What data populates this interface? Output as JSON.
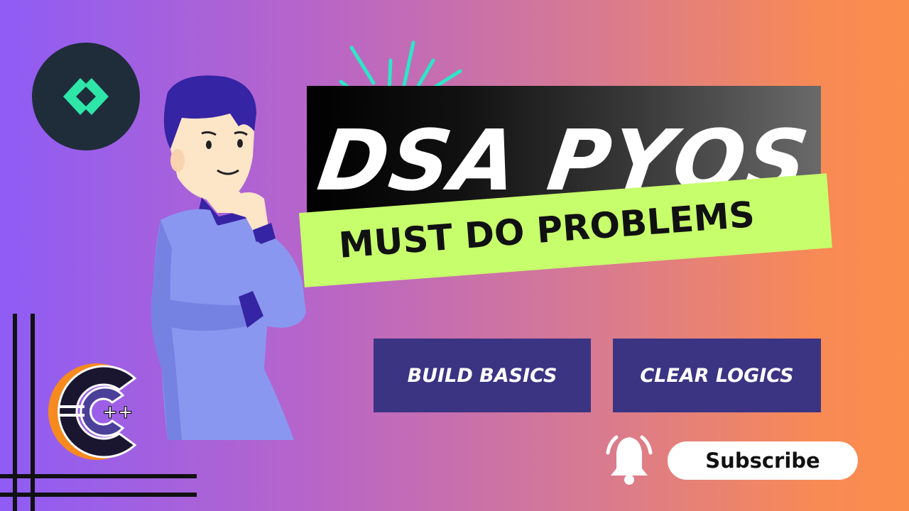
{
  "title": "DSA PYQS",
  "subtitle": "MUST DO PROBLEMS",
  "features": [
    "BUILD BASICS",
    "CLEAR LOGICS"
  ],
  "subscribe_label": "Subscribe",
  "cpp_logo_text": "C++",
  "icons": [
    "code-brackets-icon",
    "bell-icon",
    "cpp-logo"
  ],
  "colors": {
    "banner": "#c7ff6c",
    "feature_box": "#3b3483",
    "spark": "#2ee6c8",
    "code_logo_bg": "#1f2d3a",
    "code_icon": "#2ee6a8"
  }
}
